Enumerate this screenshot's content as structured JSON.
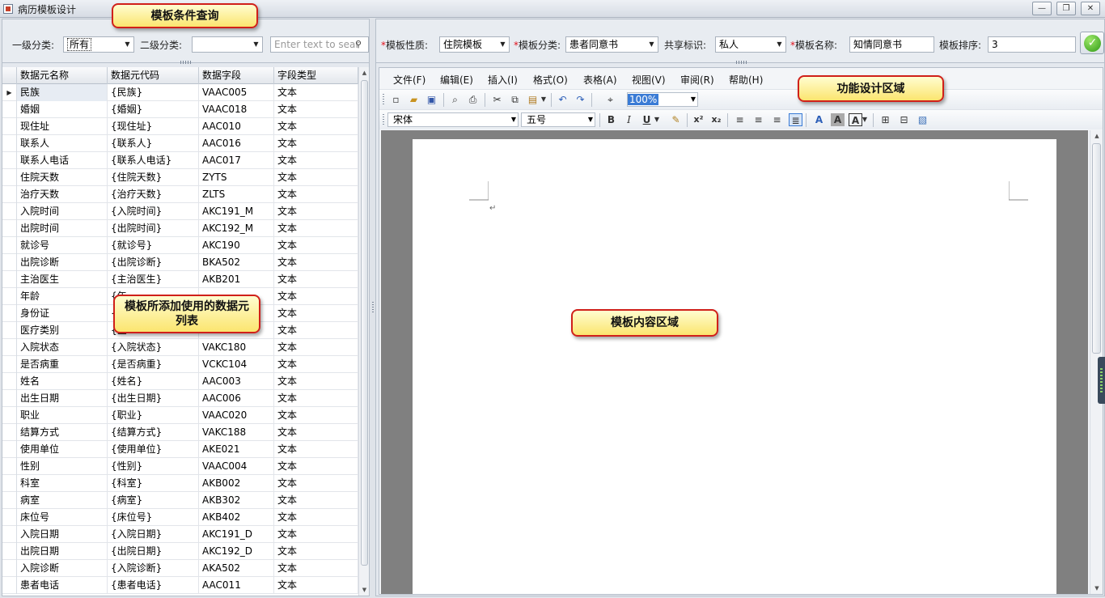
{
  "window": {
    "title": "病历模板设计",
    "minimize": "—",
    "restore": "❐",
    "close": "✕"
  },
  "callouts": {
    "query": "模板条件查询",
    "design": "功能设计区域",
    "dataset": "模板所添加使用的数据元列表",
    "content": "模板内容区域"
  },
  "query": {
    "level1_label": "一级分类:",
    "level1_value": "所有",
    "level2_label": "二级分类:",
    "level2_value": "",
    "search_placeholder": "Enter text to sear"
  },
  "grid": {
    "headers": [
      "数据元名称",
      "数据元代码",
      "数据字段",
      "字段类型"
    ],
    "rows": [
      [
        "民族",
        "{民族}",
        "VAAC005",
        "文本"
      ],
      [
        "婚姻",
        "{婚姻}",
        "VAAC018",
        "文本"
      ],
      [
        "现住址",
        "{现住址}",
        "AAC010",
        "文本"
      ],
      [
        "联系人",
        "{联系人}",
        "AAC016",
        "文本"
      ],
      [
        "联系人电话",
        "{联系人电话}",
        "AAC017",
        "文本"
      ],
      [
        "住院天数",
        "{住院天数}",
        "ZYTS",
        "文本"
      ],
      [
        "治疗天数",
        "{治疗天数}",
        "ZLTS",
        "文本"
      ],
      [
        "入院时间",
        "{入院时间}",
        "AKC191_M",
        "文本"
      ],
      [
        "出院时间",
        "{出院时间}",
        "AKC192_M",
        "文本"
      ],
      [
        "就诊号",
        "{就诊号}",
        "AKC190",
        "文本"
      ],
      [
        "出院诊断",
        "{出院诊断}",
        "BKA502",
        "文本"
      ],
      [
        "主治医生",
        "{主治医生}",
        "AKB201",
        "文本"
      ],
      [
        "年龄",
        "{年",
        "",
        "文本"
      ],
      [
        "身份证",
        "{身",
        "",
        "文本"
      ],
      [
        "医疗类别",
        "{医",
        "",
        "文本"
      ],
      [
        "入院状态",
        "{入院状态}",
        "VAKC180",
        "文本"
      ],
      [
        "是否病重",
        "{是否病重}",
        "VCKC104",
        "文本"
      ],
      [
        "姓名",
        "{姓名}",
        "AAC003",
        "文本"
      ],
      [
        "出生日期",
        "{出生日期}",
        "AAC006",
        "文本"
      ],
      [
        "职业",
        "{职业}",
        "VAAC020",
        "文本"
      ],
      [
        "结算方式",
        "{结算方式}",
        "VAKC188",
        "文本"
      ],
      [
        "使用单位",
        "{使用单位}",
        "AKE021",
        "文本"
      ],
      [
        "性别",
        "{性别}",
        "VAAC004",
        "文本"
      ],
      [
        "科室",
        "{科室}",
        "AKB002",
        "文本"
      ],
      [
        "病室",
        "{病室}",
        "AKB302",
        "文本"
      ],
      [
        "床位号",
        "{床位号}",
        "AKB402",
        "文本"
      ],
      [
        "入院日期",
        "{入院日期}",
        "AKC191_D",
        "文本"
      ],
      [
        "出院日期",
        "{出院日期}",
        "AKC192_D",
        "文本"
      ],
      [
        "入院诊断",
        "{入院诊断}",
        "AKA502",
        "文本"
      ],
      [
        "患者电话",
        "{患者电话}",
        "AAC011",
        "文本"
      ]
    ]
  },
  "form": {
    "nature_label": "模板性质:",
    "nature_value": "住院模板",
    "category_label": "模板分类:",
    "category_value": "患者同意书",
    "share_label": "共享标识:",
    "share_value": "私人",
    "name_label": "模板名称:",
    "name_value": "知情同意书",
    "order_label": "模板排序:",
    "order_value": "3",
    "required_mark": "*"
  },
  "menu": [
    "文件(F)",
    "编辑(E)",
    "插入(I)",
    "格式(O)",
    "表格(A)",
    "视图(V)",
    "审阅(R)",
    "帮助(H)"
  ],
  "toolbar": {
    "zoom": "100%",
    "font": "宋体",
    "size": "五号"
  },
  "colors": {
    "accent": "#3a7bd5",
    "required": "#e0101a",
    "callout_border": "#d0201a",
    "callout_fill": "#fbe56f"
  }
}
